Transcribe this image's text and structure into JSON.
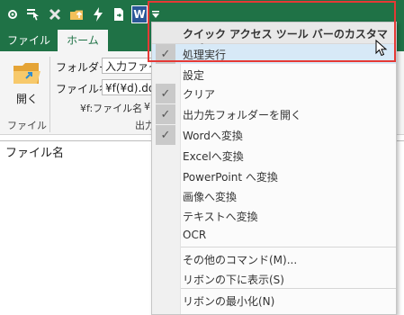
{
  "quick_access": {
    "icons": [
      "settings-icon",
      "pointer-icon",
      "delete-icon",
      "folder-up-icon",
      "flash-icon",
      "document-arrow-icon",
      "word-icon",
      "dropdown-arrow-icon"
    ],
    "word_badge": "W"
  },
  "tabs": [
    {
      "label": "ファイル",
      "active": false
    },
    {
      "label": "ホーム",
      "active": true
    }
  ],
  "ribbon": {
    "open_label": "開く",
    "file_group_label": "ファイル",
    "folder_label": "フォルダー",
    "folder_value": "入力ファイ",
    "filename_label": "ファイル名",
    "filename_value": "¥f(¥d).doc",
    "macro_hint": "¥f:ファイル名",
    "macro_hint2": "¥",
    "output_group_partial": "出力"
  },
  "grid": {
    "column_header": "ファイル名"
  },
  "menu": {
    "header": "クイック アクセス ツール バーのカスタマイズ(C)",
    "items": [
      {
        "label": "処理実行",
        "checked": true,
        "hover": true
      },
      {
        "label": "設定",
        "checked": false
      },
      {
        "label": "クリア",
        "checked": true
      },
      {
        "label": "出力先フォルダーを開く",
        "checked": true
      },
      {
        "label": "Wordへ変換",
        "checked": true
      },
      {
        "label": "Excelへ変換",
        "checked": false
      },
      {
        "label": "PowerPoint へ変換",
        "checked": false
      },
      {
        "label": "画像へ変換",
        "checked": false
      },
      {
        "label": "テキストへ変換",
        "checked": false
      },
      {
        "label": "OCR",
        "checked": false
      },
      {
        "label": "その他のコマンド(M)...",
        "checked": false
      },
      {
        "label": "リボンの下に表示(S)",
        "checked": false
      },
      {
        "label": "リボンの最小化(N)",
        "checked": false
      }
    ],
    "check_glyph": "✓"
  },
  "colors": {
    "excel_green": "#1f7246",
    "callout_red": "#e53935",
    "hover_blue": "#d7e9f7"
  }
}
